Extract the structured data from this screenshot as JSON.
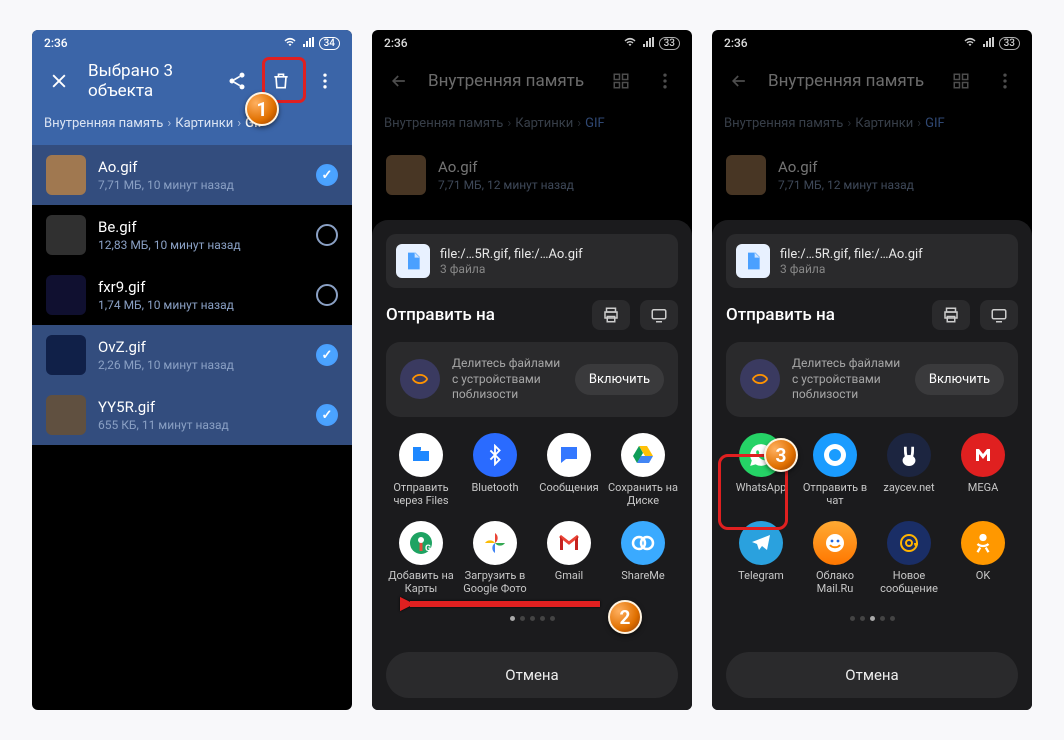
{
  "status": {
    "time": "2:36",
    "battery1": "34",
    "battery23": "33"
  },
  "p1": {
    "title": "Выбрано 3 объекта",
    "crumbs": [
      "Внутренняя память",
      "Картинки",
      "GIF"
    ],
    "files": [
      {
        "name": "Ao.gif",
        "meta": "7,71 МБ, 10 минут назад",
        "sel": true,
        "thumb": "#a07850"
      },
      {
        "name": "Be.gif",
        "meta": "12,83 МБ, 10 минут назад",
        "sel": false,
        "thumb": "#303030"
      },
      {
        "name": "fxr9.gif",
        "meta": "1,74 МБ, 10 минут назад",
        "sel": false,
        "thumb": "#101030"
      },
      {
        "name": "OvZ.gif",
        "meta": "2,26 МБ, 10 минут назад",
        "sel": true,
        "thumb": "#102048"
      },
      {
        "name": "YY5R.gif",
        "meta": "655 КБ, 11 минут назад",
        "sel": true,
        "thumb": "#605040"
      }
    ]
  },
  "darkHeader": {
    "title": "Внутренняя память",
    "crumbs": [
      "Внутренняя память",
      "Картинки",
      "GIF"
    ]
  },
  "topFile": {
    "name": "Ao.gif",
    "meta": "7,71 МБ, 12 минут назад",
    "thumb": "#a07850"
  },
  "sheet": {
    "fileTitle": "file:/…5R.gif, file:/…Ao.gif",
    "fileCount": "3 файла",
    "sendTo": "Отправить на",
    "nearby": "Делитесь файлами с устройствами поблизости",
    "enable": "Включить",
    "cancel": "Отмена"
  },
  "apps2": [
    {
      "label": "Отправить через Files",
      "bg": "ic-files"
    },
    {
      "label": "Bluetooth",
      "bg": "ic-bt"
    },
    {
      "label": "Сообщения",
      "bg": "ic-msg"
    },
    {
      "label": "Сохранить на Диске",
      "bg": "ic-drive"
    },
    {
      "label": "Добавить на Карты",
      "bg": "ic-maps"
    },
    {
      "label": "Загрузить в Google Фото",
      "bg": "ic-photos"
    },
    {
      "label": "Gmail",
      "bg": "ic-gmail"
    },
    {
      "label": "ShareMe",
      "bg": "ic-shareme"
    }
  ],
  "apps3": [
    {
      "label": "WhatsApp",
      "bg": "ic-whatsapp"
    },
    {
      "label": "Отправить в чат",
      "bg": "ic-sendchat"
    },
    {
      "label": "zaycev.net",
      "bg": "ic-zaycev"
    },
    {
      "label": "MEGA",
      "bg": "ic-mega"
    },
    {
      "label": "Telegram",
      "bg": "ic-telegram"
    },
    {
      "label": "Облако Mail.Ru",
      "bg": "ic-mailru"
    },
    {
      "label": "Новое сообщение",
      "bg": "ic-mailmsg"
    },
    {
      "label": "OK",
      "bg": "ic-ok"
    }
  ],
  "badges": {
    "b1": "1",
    "b2": "2",
    "b3": "3"
  }
}
